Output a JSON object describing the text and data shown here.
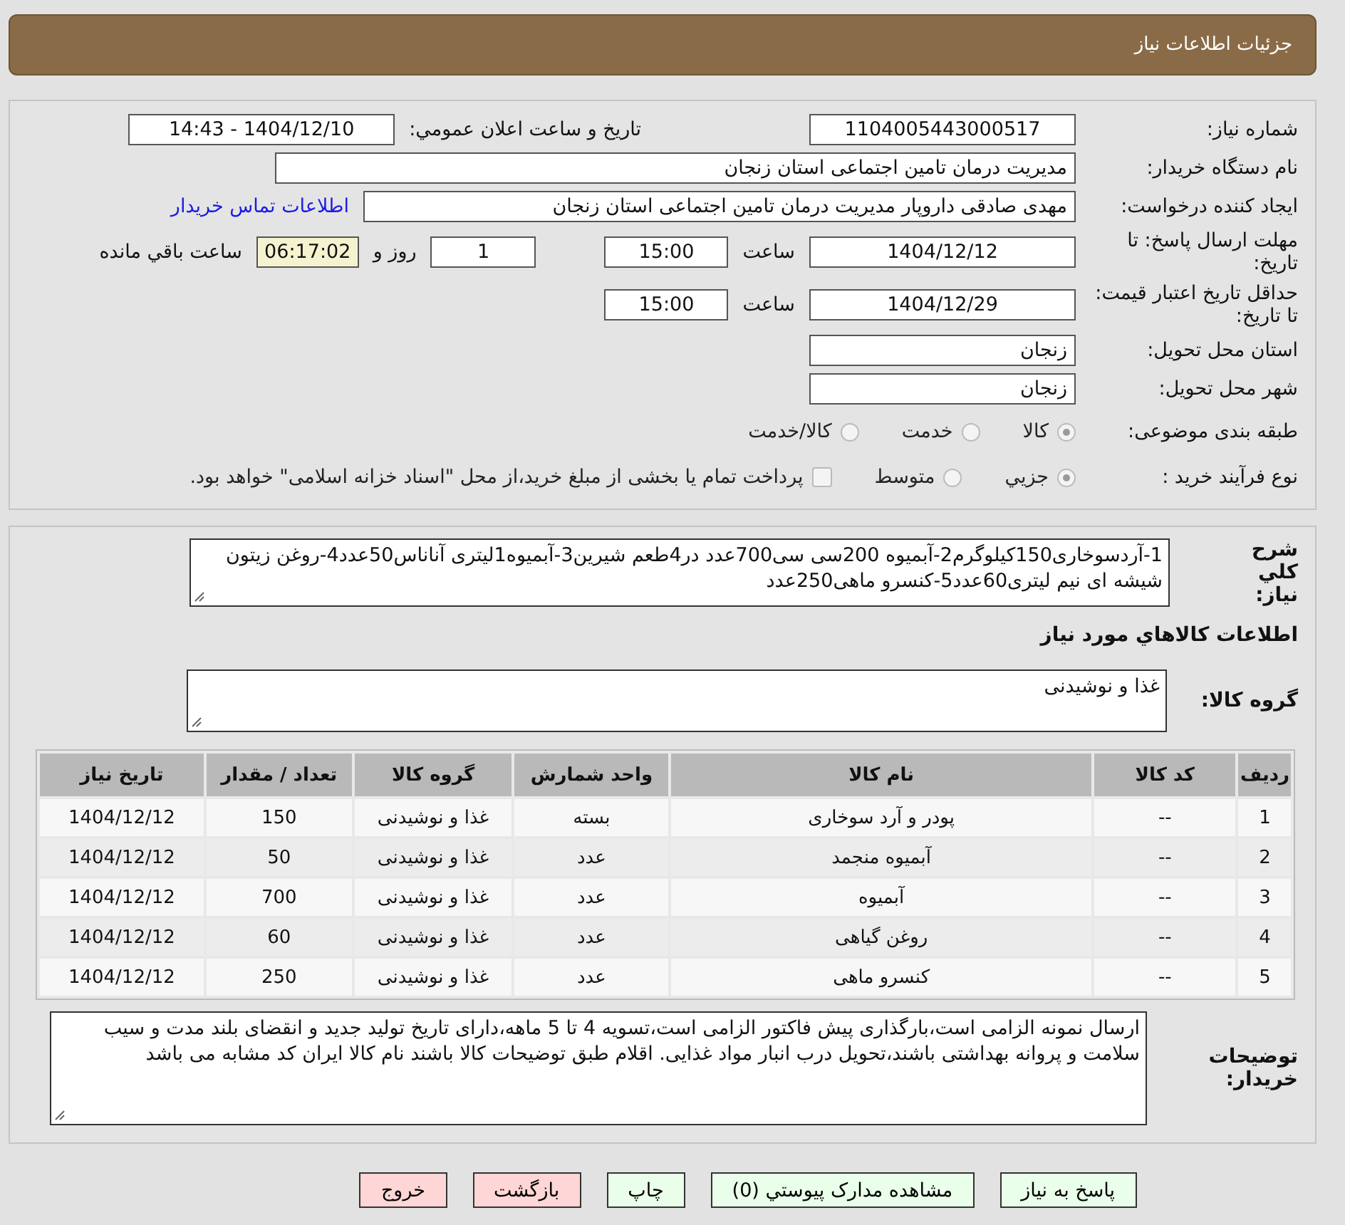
{
  "header": {
    "title": "جزئیات اطلاعات نیاز"
  },
  "need_number": {
    "label": "شماره نیاز:",
    "value": "1104005443000517"
  },
  "announce": {
    "label": "تاريخ و ساعت اعلان عمومي:",
    "value": "1404/12/10 - 14:43"
  },
  "buyer_org": {
    "label": "نام دستگاه خریدار:",
    "value": "مدیریت درمان تامین اجتماعی استان زنجان"
  },
  "requester": {
    "label": "ایجاد کننده درخواست:",
    "value": "مهدی صادقی داروپار مدیریت درمان تامین اجتماعی استان زنجان",
    "link": "اطلاعات تماس خریدار"
  },
  "deadline": {
    "label": "مهلت ارسال پاسخ: تا تاریخ:",
    "date": "1404/12/12",
    "time_label": "ساعت",
    "time": "15:00",
    "days": "1",
    "days_label": "روز و",
    "remaining": "06:17:02",
    "remaining_label": "ساعت باقي مانده"
  },
  "validity": {
    "label": "حداقل تاریخ اعتبار قیمت: تا تاریخ:",
    "date": "1404/12/29",
    "time_label": "ساعت",
    "time": "15:00"
  },
  "province": {
    "label": "استان محل تحویل:",
    "value": "زنجان"
  },
  "city": {
    "label": "شهر محل تحویل:",
    "value": "زنجان"
  },
  "category": {
    "label": "طبقه بندی موضوعی:",
    "options": [
      {
        "label": "کالا",
        "selected": true
      },
      {
        "label": "خدمت",
        "selected": false
      },
      {
        "label": "کالا/خدمت",
        "selected": false
      }
    ]
  },
  "process": {
    "label": "نوع فرآیند خرید :",
    "options": [
      {
        "label": "جزيي",
        "selected": true
      },
      {
        "label": "متوسط",
        "selected": false
      }
    ],
    "payment": {
      "label": "پرداخت تمام یا بخشی از مبلغ خرید،از محل \"اسناد خزانه اسلامی\" خواهد بود.",
      "checked": false
    }
  },
  "description": {
    "label": "شرح کلي نياز:",
    "value": "1-آردسوخاری150کیلوگرم2-آبمیوه 200سی سی700عدد در4طعم شیرین3-آبمیوه1لیتری آناناس50عدد4-روغن زیتون شیشه ای نیم لیتری60عدد5-کنسرو ماهی250عدد"
  },
  "goods_heading": "اطلاعات کالاهاي مورد نياز",
  "goods_group": {
    "label": "گروه کالا:",
    "value": "غذا و نوشیدنی"
  },
  "table": {
    "columns": [
      "ردیف",
      "کد کالا",
      "نام کالا",
      "واحد شمارش",
      "گروه کالا",
      "تعداد / مقدار",
      "تاریخ نیاز"
    ],
    "rows": [
      [
        "1",
        "--",
        "پودر و آرد سوخاری",
        "بسته",
        "غذا و نوشیدنی",
        "150",
        "1404/12/12"
      ],
      [
        "2",
        "--",
        "آبمیوه منجمد",
        "عدد",
        "غذا و نوشیدنی",
        "50",
        "1404/12/12"
      ],
      [
        "3",
        "--",
        "آبمیوه",
        "عدد",
        "غذا و نوشیدنی",
        "700",
        "1404/12/12"
      ],
      [
        "4",
        "--",
        "روغن گیاهی",
        "عدد",
        "غذا و نوشیدنی",
        "60",
        "1404/12/12"
      ],
      [
        "5",
        "--",
        "کنسرو ماهی",
        "عدد",
        "غذا و نوشیدنی",
        "250",
        "1404/12/12"
      ]
    ]
  },
  "notes": {
    "label": "توضیحات خریدار:",
    "value": "ارسال نمونه الزامی است،بارگذاری پیش فاکتور الزامی است،تسویه 4 تا 5 ماهه،دارای تاریخ تولید جدید و انقضای بلند مدت و سیب سلامت و پروانه بهداشتی باشند،تحویل درب انبار مواد غذایی. اقلام طبق توضیحات کالا باشند نام کالا ایران کد مشابه می باشد"
  },
  "buttons": [
    {
      "label": "پاسخ به نیاز",
      "kind": "normal"
    },
    {
      "label": "مشاهده مدارک پیوستي (0)",
      "kind": "normal"
    },
    {
      "label": "چاپ",
      "kind": "normal"
    },
    {
      "label": "بازگشت",
      "kind": "danger"
    },
    {
      "label": "خروج",
      "kind": "danger"
    }
  ]
}
